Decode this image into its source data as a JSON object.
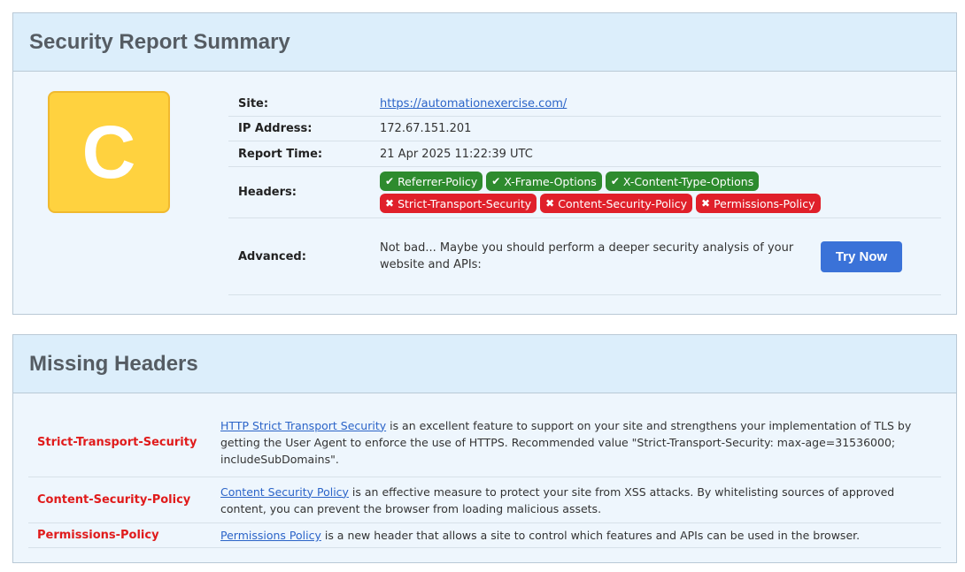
{
  "summary": {
    "title": "Security Report Summary",
    "grade": "C",
    "grade_color": "#ffd23f",
    "site_label": "Site:",
    "site_value": "https://automationexercise.com/",
    "ip_label": "IP Address:",
    "ip_value": "172.67.151.201",
    "time_label": "Report Time:",
    "time_value": "21 Apr 2025 11:22:39 UTC",
    "headers_label": "Headers:",
    "present_headers": [
      "Referrer-Policy",
      "X-Frame-Options",
      "X-Content-Type-Options"
    ],
    "missing_headers": [
      "Strict-Transport-Security",
      "Content-Security-Policy",
      "Permissions-Policy"
    ],
    "advanced_label": "Advanced:",
    "advanced_text": "Not bad... Maybe you should perform a deeper security analysis of your website and APIs:",
    "try_button": "Try Now",
    "ok_color": "#2e8b2e",
    "bad_color": "#e0202a"
  },
  "missing": {
    "title": "Missing Headers",
    "rows": [
      {
        "name": "Strict-Transport-Security",
        "link": "HTTP Strict Transport Security",
        "text": " is an excellent feature to support on your site and strengthens your implementation of TLS by getting the User Agent to enforce the use of HTTPS. Recommended value \"Strict-Transport-Security: max-age=31536000; includeSubDomains\"."
      },
      {
        "name": "Content-Security-Policy",
        "link": "Content Security Policy",
        "text": " is an effective measure to protect your site from XSS attacks. By whitelisting sources of approved content, you can prevent the browser from loading malicious assets."
      },
      {
        "name": "Permissions-Policy",
        "link": "Permissions Policy",
        "text": " is a new header that allows a site to control which features and APIs can be used in the browser."
      }
    ]
  }
}
